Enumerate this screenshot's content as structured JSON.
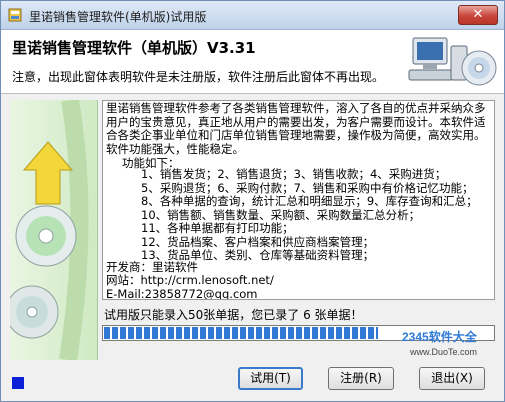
{
  "window": {
    "title": "里诺销售管理软件(单机版)试用版",
    "close_symbol": "✕"
  },
  "header": {
    "app_title": "里诺销售管理软件（单机版）V3.31",
    "notice": "注意，出现此窗体表明软件是未注册版，软件注册后此窗体不再出现。"
  },
  "description": {
    "intro": "里诺销售管理软件参考了各类销售管理软件，溶入了各自的优点并采纳众多用户的宝贵意见，真正地从用户的需要出发，为客户需要而设计。本软件适合各类企事业单位和门店单位销售管理地需要，操作极为简便，高效实用。软件功能强大，性能稳定。",
    "features_title": "功能如下：",
    "features": [
      "1、销售发货；2、销售退货；3、销售收款；4、采购进货；",
      "5、采购退货；6、采购付款；7、销售和采购中有价格记忆功能；",
      "8、各种单据的查询，统计汇总和明细显示；9、库存查询和汇总；",
      "10、销售额、销售数量、采购额、采购数量汇总分析；",
      "11、各种单据都有打印功能；",
      "12、货品档案、客户档案和供应商档案管理；",
      "13、货品单位、类别、仓库等基础资料管理；"
    ],
    "developer": "开发商：里诺软件",
    "website": "网站：http://crm.lenosoft.net/",
    "email": "E-Mail:23858772@qq.com"
  },
  "trial": {
    "message": "试用版只能录入50张单据，您已录了 6 张单据！",
    "progress_fraction": 0.7
  },
  "buttons": {
    "trial": "试用(T)",
    "register": "注册(R)",
    "exit": "退出(X)"
  },
  "watermark": {
    "brand": "2345软件大全",
    "url": "www.DuoTe.com"
  },
  "colors": {
    "progress": "#2f78d6",
    "status_square": "#0a1fd6",
    "left_panel": "#d8eecd"
  }
}
